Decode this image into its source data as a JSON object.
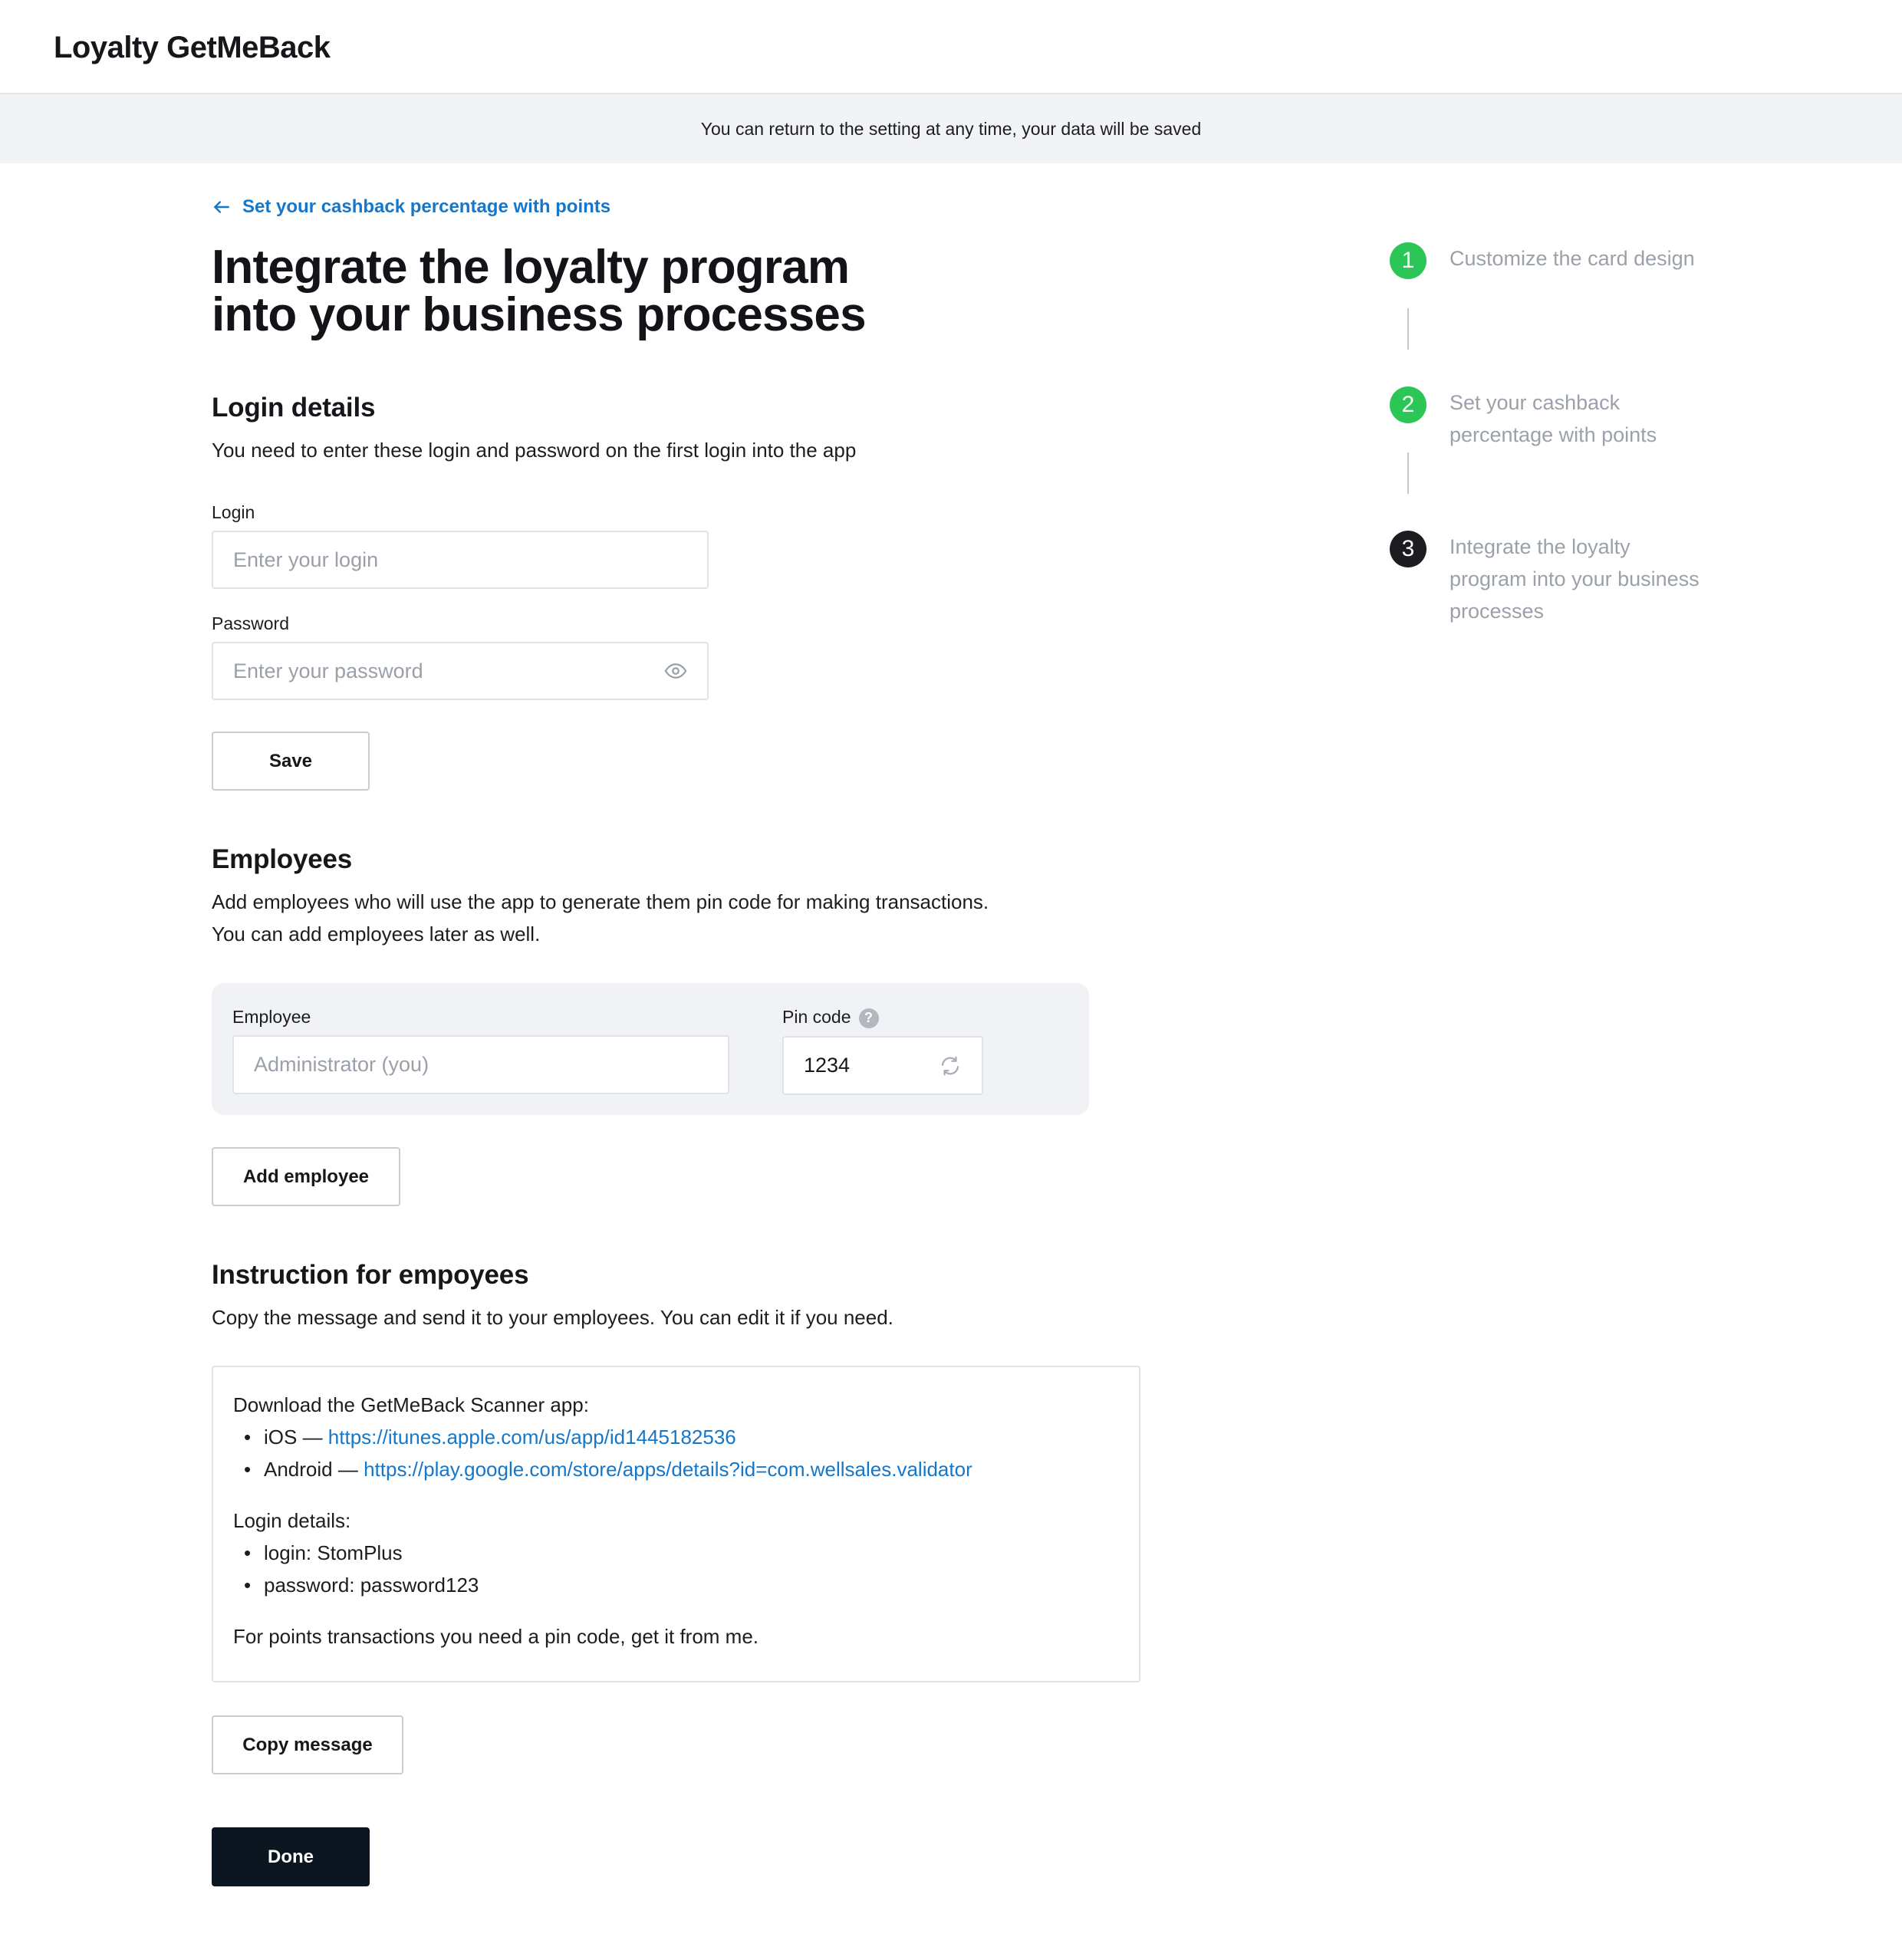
{
  "app": {
    "title": "Loyalty GetMeBack"
  },
  "notice": "You can return to the setting at any time, your data will be saved",
  "back_link": {
    "label": "Set your cashback percentage with points"
  },
  "page_title": {
    "line1": "Integrate the loyalty program",
    "line2": "into your business processes"
  },
  "login": {
    "heading": "Login details",
    "description": "You need to enter these login and password on the first login into the app",
    "login_label": "Login",
    "login_placeholder": "Enter your login",
    "password_label": "Password",
    "password_placeholder": "Enter your password",
    "save_label": "Save"
  },
  "employees": {
    "heading": "Employees",
    "description_line1": "Add employees who will use the app to generate them pin code for making transactions.",
    "description_line2": "You can add employees later as well.",
    "employee_label": "Employee",
    "employee_placeholder": "Administrator (you)",
    "pin_label": "Pin code",
    "pin_help": "?",
    "pin_value": "1234",
    "add_label": "Add employee"
  },
  "instruction": {
    "heading": "Instruction for empoyees",
    "description": "Copy the message and send it to your employees. You can edit it if you need.",
    "message": {
      "download": "Download the GetMeBack Scanner app:",
      "ios_prefix": "iOS — ",
      "ios_link": "https://itunes.apple.com/us/app/id1445182536",
      "android_prefix": "Android — ",
      "android_link": "https://play.google.com/store/apps/details?id=com.wellsales.validator",
      "login_details": "Login details:",
      "login_line": "login: StomPlus",
      "password_line": "password: password123",
      "footer": "For points transactions you need a pin code, get it from me."
    },
    "copy_label": "Copy message"
  },
  "done_label": "Done",
  "steps": [
    {
      "number": "1",
      "label": "Customize the card design",
      "state": "done"
    },
    {
      "number": "2",
      "label": "Set your cashback percentage with points",
      "state": "done"
    },
    {
      "number": "3",
      "label": "Integrate the loyalty program into your business processes",
      "state": "current"
    }
  ],
  "colors": {
    "accent": "#1677c9",
    "done": "#2cc656",
    "primary_button": "#0c1620",
    "notice_bg": "#f2f3f6"
  },
  "icons": {
    "back": "arrow-left-icon",
    "password": "eye-icon",
    "pin_refresh": "refresh-icon",
    "help": "question-icon"
  }
}
